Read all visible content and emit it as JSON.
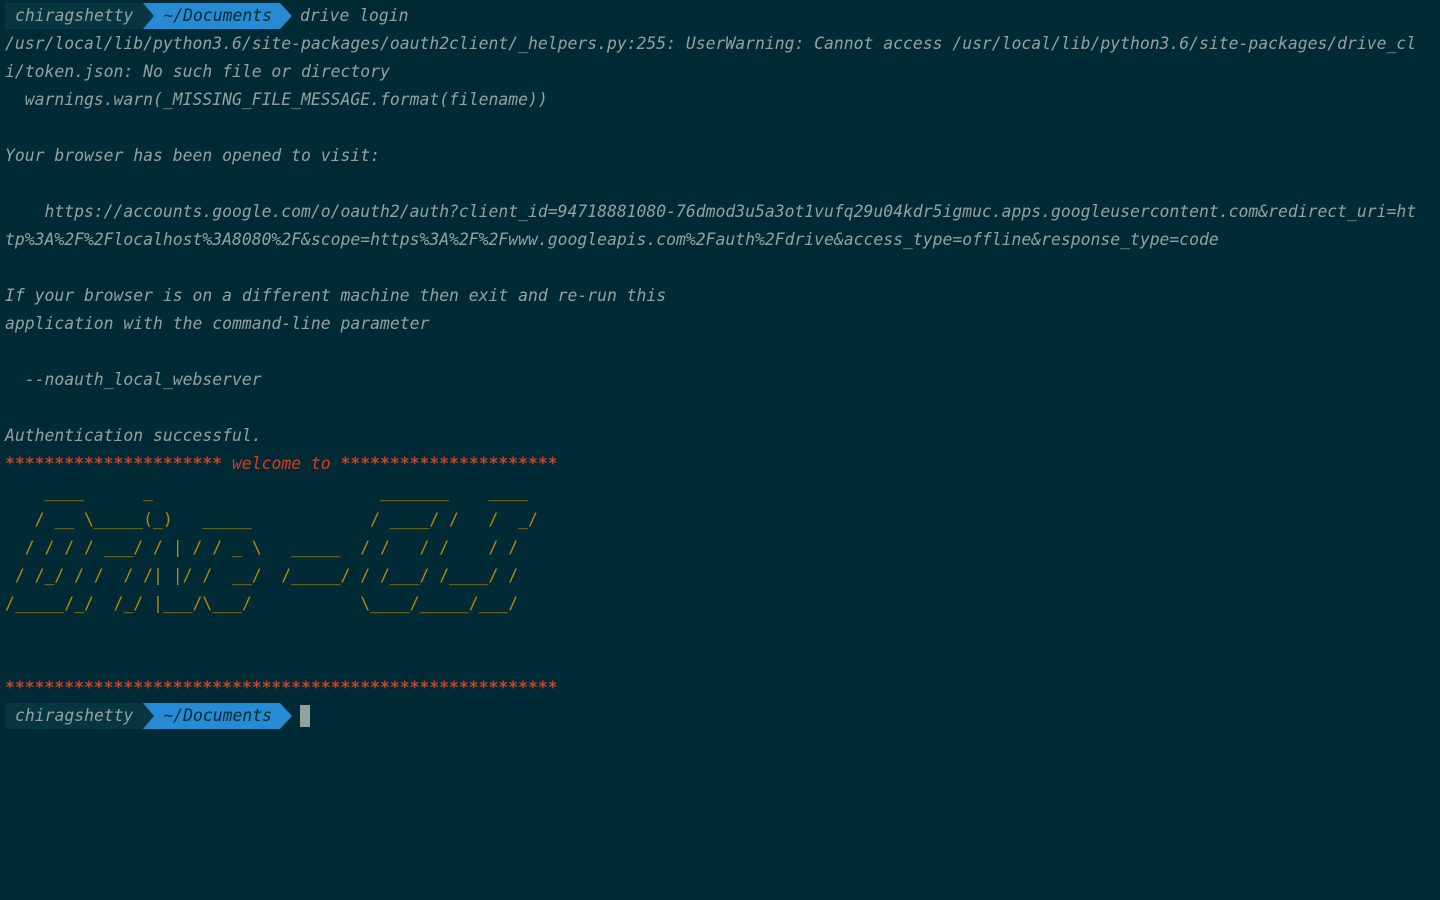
{
  "prompt": {
    "user": "chiragshetty",
    "dir": "~/Documents",
    "command": "drive login"
  },
  "output": {
    "warning_line1": "/usr/local/lib/python3.6/site-packages/oauth2client/_helpers.py:255: UserWarning: Cannot access /usr/local/lib/python3.6/site-packages/drive_cl",
    "warning_line2": "i/token.json: No such file or directory",
    "warning_line3": "  warnings.warn(_MISSING_FILE_MESSAGE.format(filename))",
    "browser_opened": "Your browser has been opened to visit:",
    "url_line1": "    https://accounts.google.com/o/oauth2/auth?client_id=94718881080-76dmod3u5a3ot1vufq29u04kdr5igmuc.apps.googleusercontent.com&redirect_uri=ht",
    "url_line2": "tp%3A%2F%2Flocalhost%3A8080%2F&scope=https%3A%2F%2Fwww.googleapis.com%2Fauth%2Fdrive&access_type=offline&response_type=code",
    "different_machine1": "If your browser is on a different machine then exit and re-run this",
    "different_machine2": "application with the command-line parameter",
    "param": "  --noauth_local_webserver",
    "auth_success": "Authentication successful.",
    "stars_left": "**********************",
    "welcome": "welcome to",
    "stars_right": "**********************",
    "stars_full": "********************************************************"
  },
  "banner": {
    "line1": "    ____      _                       _______    ____",
    "line2": "   / __ \\_____(_)   _____            / ____/ /   /  _/",
    "line3": "  / / / / ___/ / | / / _ \\   _____  / /   / /    / /",
    "line4": " / /_/ / /  / /| |/ /  __/  /_____/ / /___/ /____/ /",
    "line5": "/_____/_/  /_/ |___/\\___/           \\____/_____/___/"
  },
  "prompt2": {
    "user": "chiragshetty",
    "dir": "~/Documents"
  },
  "colors": {
    "background": "#002b36",
    "text": "#93a1a1",
    "user_segment": "#073642",
    "dir_segment": "#268bd2",
    "accent_red": "#dc3b17",
    "banner_yellow": "#b58900"
  }
}
